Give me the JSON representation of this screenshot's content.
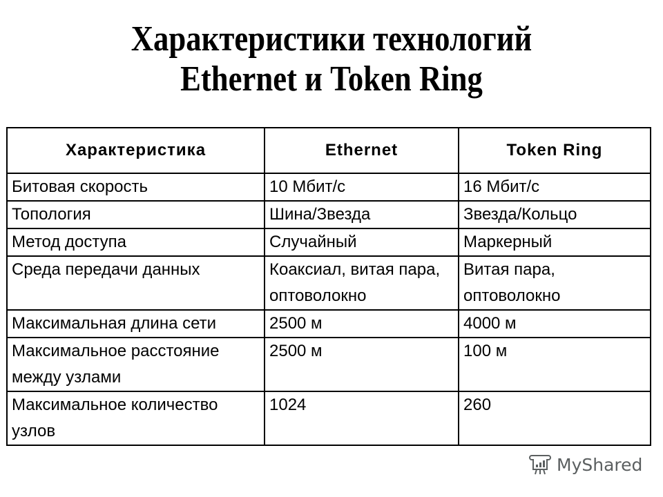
{
  "title": {
    "line1": "Характеристики технологий",
    "line2": "Ethernet и Token Ring"
  },
  "table": {
    "headers": [
      "Характеристика",
      "Ethernet",
      "Token Ring"
    ],
    "rows": [
      [
        "Битовая скорость",
        "10 Мбит/с",
        "16 Мбит/с"
      ],
      [
        "Топология",
        "Шина/Звезда",
        "Звезда/Кольцо"
      ],
      [
        "Метод доступа",
        "Случайный",
        "Маркерный"
      ],
      [
        "Среда передачи данных",
        "Коаксиал, витая пара, оптоволокно",
        "Витая пара, оптоволокно"
      ],
      [
        "Максимальная длина сети",
        "2500 м",
        "4000 м"
      ],
      [
        "Максимальное расстояние между узлами",
        "2500 м",
        "100 м"
      ],
      [
        "Максимальное количество узлов",
        "1024",
        "260"
      ]
    ]
  },
  "logo": {
    "icon": "presentation-board-icon",
    "text": "MyShared",
    "color": "#5b5f60"
  }
}
